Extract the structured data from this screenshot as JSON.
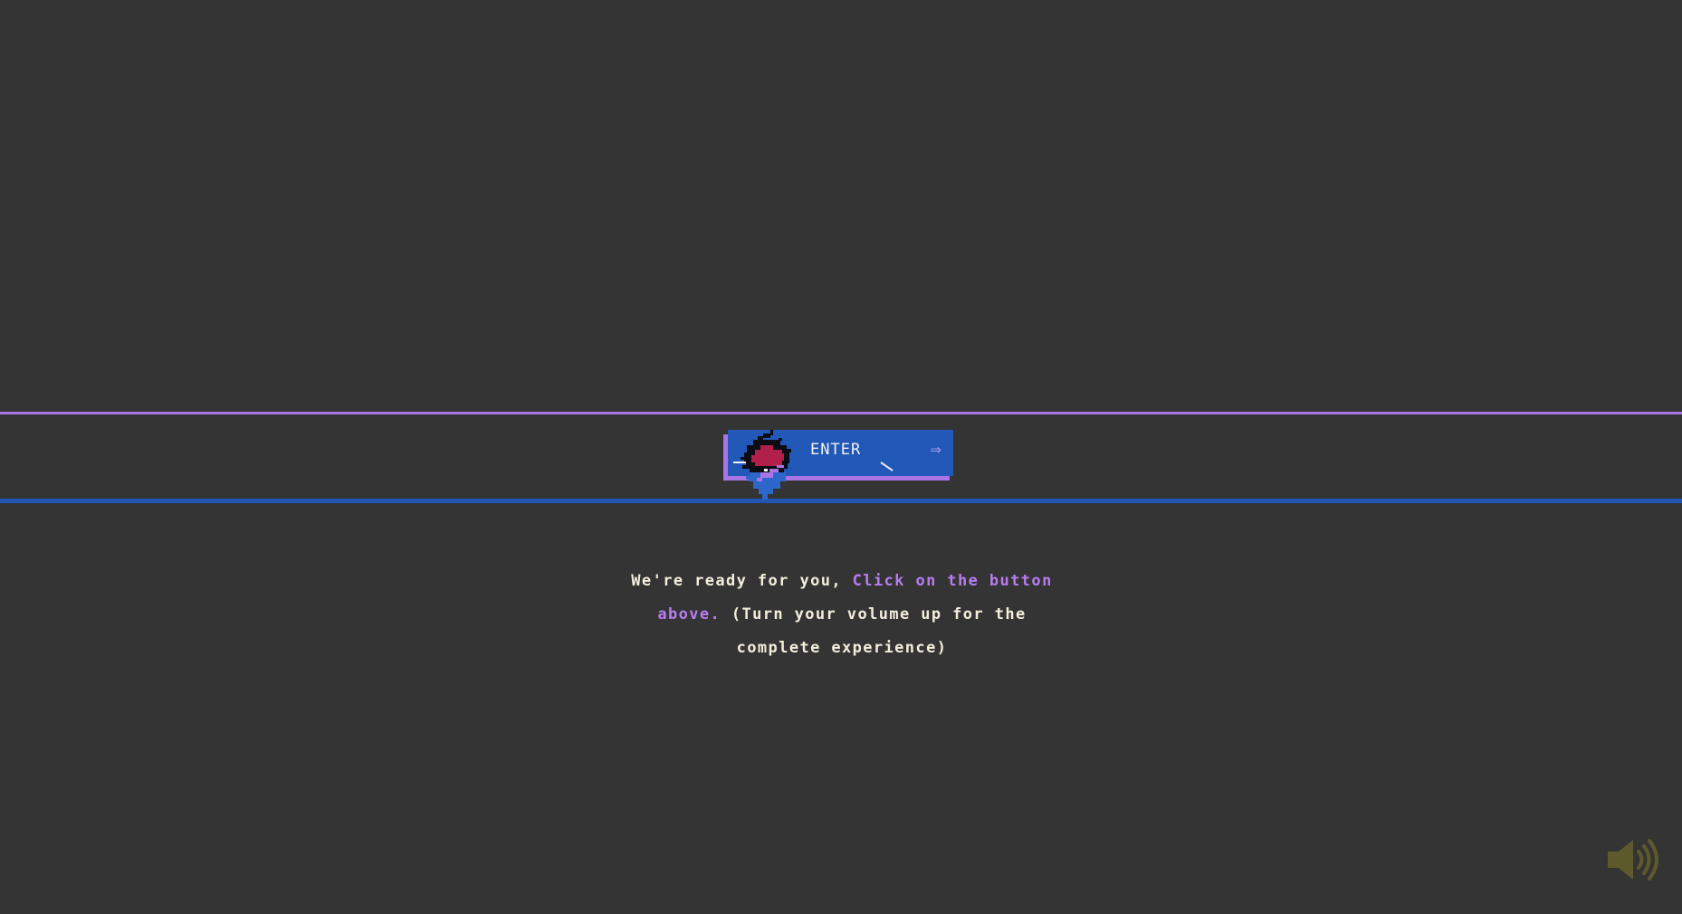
{
  "enter_button": {
    "label": "ENTER",
    "arrow": "⇒"
  },
  "message": {
    "part1": "We're ready for you, ",
    "part2_accent": "Click on the button above.",
    "part3": " (Turn your volume up for the complete experience)"
  },
  "icons": {
    "volume": "speaker-volume-icon",
    "arrow": "double-arrow-right-icon"
  },
  "colors": {
    "background": "#343434",
    "accent_purple": "#a874e6",
    "accent_blue": "#2258b8",
    "text": "#f3eedc",
    "volume_icon": "#5d5a2c"
  }
}
